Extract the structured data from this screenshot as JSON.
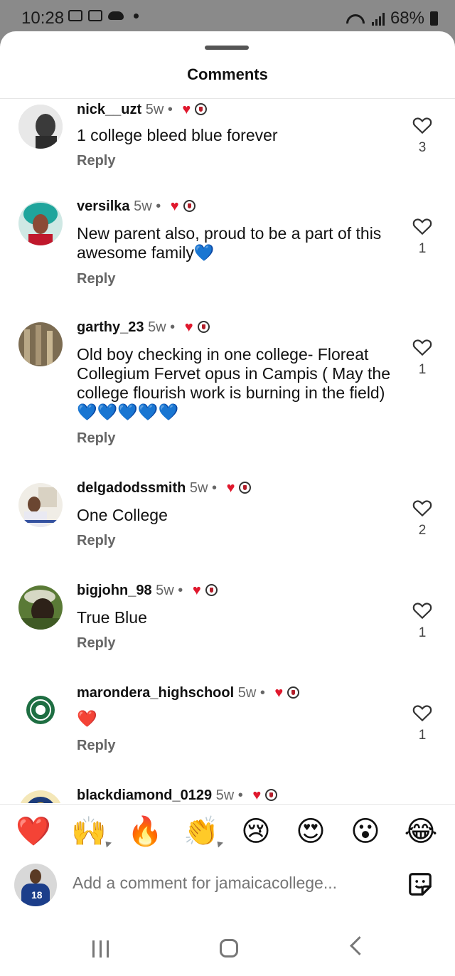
{
  "status_bar": {
    "time": "10:28",
    "battery": "68%"
  },
  "sheet": {
    "title": "Comments"
  },
  "comments": [
    {
      "username": "nick__uzt",
      "meta": "5w •",
      "text": "1 college bleed blue forever",
      "reply": "Reply",
      "likes": "3"
    },
    {
      "username": "versilka",
      "meta": "5w •",
      "text": "New parent also, proud to be a part of this awesome family💙",
      "reply": "Reply",
      "likes": "1"
    },
    {
      "username": "garthy_23",
      "meta": "5w •",
      "text": "Old boy checking in one college- Floreat Collegium Fervet opus in Campis ( May the college flourish work is burning in the field)💙💙💙💙💙",
      "reply": "Reply",
      "likes": "1"
    },
    {
      "username": "delgadodssmith",
      "meta": "5w •",
      "text": "One College",
      "reply": "Reply",
      "likes": "2"
    },
    {
      "username": "bigjohn_98",
      "meta": "5w •",
      "text": "True Blue",
      "reply": "Reply",
      "likes": "1"
    },
    {
      "username": "marondera_highschool",
      "meta": "5w •",
      "text": "❤️",
      "reply": "Reply",
      "likes": "1"
    },
    {
      "username": "blackdiamond_0129",
      "meta": "5w •"
    }
  ],
  "quick_reactions": [
    "❤️",
    "🙌",
    "🔥",
    "👏",
    "😢",
    "😍",
    "😮",
    "😂"
  ],
  "composer": {
    "placeholder": "Add a comment for jamaicacollege...",
    "avatar_number": "18"
  },
  "colors": {
    "reaction_red": "#e0182d",
    "blue_heart": "#1e8fe8",
    "muted_text": "#666666"
  }
}
